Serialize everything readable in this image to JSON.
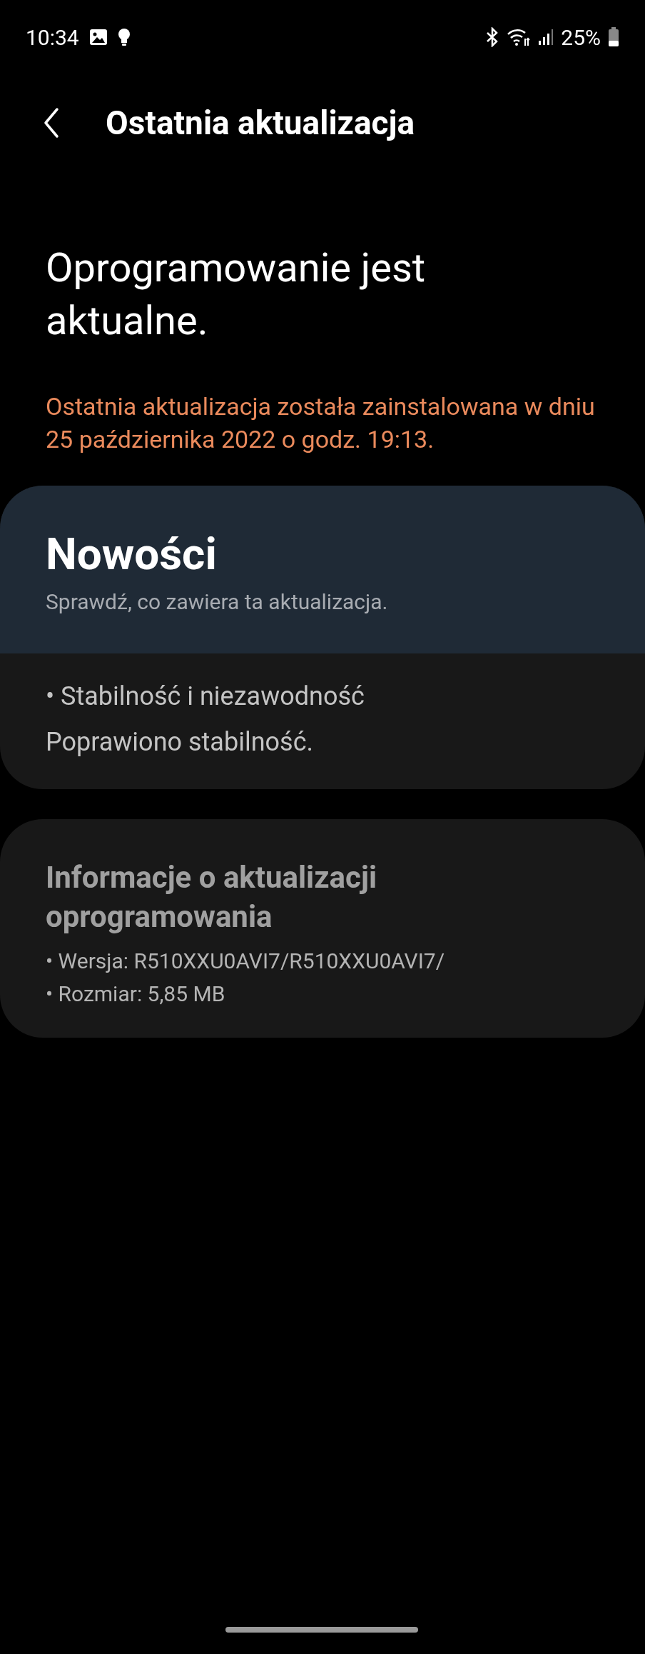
{
  "status_bar": {
    "time": "10:34",
    "battery": "25%"
  },
  "header": {
    "title": "Ostatnia aktualizacja"
  },
  "status": {
    "heading": "Oprogramowanie jest aktualne.",
    "note": "Ostatnia aktualizacja została zainstalowana w dniu 25 października 2022 o godz. 19:13."
  },
  "whats_new": {
    "title": "Nowości",
    "subtitle": "Sprawdź, co zawiera ta aktualizacja.",
    "items": [
      "• Stabilność i niezawodność",
      "Poprawiono stabilność."
    ]
  },
  "update_info": {
    "title": "Informacje o aktualizacji oprogramowania",
    "items": [
      "• Wersja: R510XXU0AVI7/R510XXU0AVI7/",
      "• Rozmiar: 5,85 MB"
    ]
  }
}
